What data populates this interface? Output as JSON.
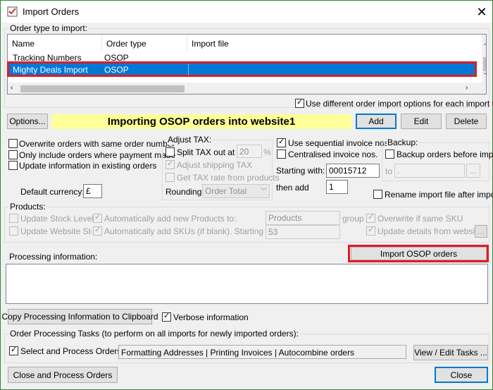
{
  "window": {
    "title": "Import Orders",
    "close_glyph": "✕"
  },
  "order_type": {
    "group_label": "Order type to import:",
    "columns": [
      "Name",
      "Order type",
      "Import file"
    ],
    "rows": [
      {
        "name": "Tracking Numbers",
        "order_type": "OSOP",
        "import_file": ""
      },
      {
        "name": "Mighty Deals Import",
        "order_type": "OSOP",
        "import_file": ""
      }
    ],
    "use_different_options_label": "Use different order import options for each import type"
  },
  "toolbar": {
    "options_label": "Options...",
    "banner": "Importing OSOP orders into website1",
    "add_label": "Add",
    "edit_label": "Edit",
    "delete_label": "Delete"
  },
  "options": {
    "overwrite_label": "Overwrite orders with same order number",
    "only_paid_label": "Only include orders where payment made",
    "update_existing_label": "Update information in existing orders",
    "default_currency_label": "Default currency:",
    "default_currency_value": "£"
  },
  "adjust_tax": {
    "group_label": "Adjust TAX:",
    "split_label": "Split TAX out at",
    "split_value": "20",
    "percent": "%",
    "adjust_shipping_label": "Adjust shipping TAX",
    "get_rate_label": "Get TAX rate from products",
    "rounding_label": "Rounding:",
    "rounding_value": "Order Total"
  },
  "invoice": {
    "sequential_label": "Use sequential invoice nos.",
    "centralised_label": "Centralised invoice nos.",
    "starting_label": "Starting with:",
    "starting_value": "00015712",
    "then_add_label": "then add",
    "then_add_value": "1"
  },
  "backup": {
    "group_label": "Backup:",
    "before_import_label": "Backup orders before import",
    "to_label": "to",
    "to_value": ".",
    "browse": "...",
    "rename_label": "Rename import file after import"
  },
  "products": {
    "group_label": "Products:",
    "update_stock_label": "Update Stock Levels",
    "update_website_label": "Update Website Stoc",
    "auto_add_products_label": "Automatically add new Products to:",
    "auto_add_skus_label": "Automatically add SKUs (if blank). Starting with:",
    "products_group_value": "Products",
    "group_word": "group",
    "sku_start_value": "53",
    "overwrite_sku_label": "Overwrite if same SKU",
    "update_details_label": "Update details from website",
    "browse": "..."
  },
  "processing": {
    "label": "Processing information:",
    "import_button": "Import OSOP orders",
    "copy_button": "Copy Processing Information to Clipboard",
    "verbose_label": "Verbose information"
  },
  "tasks": {
    "group_label": "Order Processing Tasks (to perform on all imports for newly imported orders):",
    "select_process_label": "Select and Process Orders",
    "tasks_value": "Formatting Addresses | Printing Invoices | Autocombine orders",
    "view_edit_label": "View / Edit Tasks ..."
  },
  "footer": {
    "close_process_label": "Close and Process Orders",
    "close_label": "Close"
  },
  "colors": {
    "selection": "#0078d7",
    "highlight_red": "#e01b24",
    "banner_yellow": "#ffff99"
  }
}
